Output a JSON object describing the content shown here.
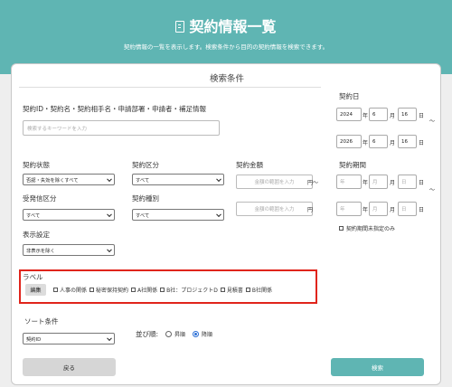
{
  "header": {
    "title": "契約情報一覧",
    "subtitle": "契約情報の一覧を表示します。検索条件から目的の契約情報を検索できます。"
  },
  "panel": {
    "title": "検索条件",
    "keyword": {
      "label": "契約ID・契約名・契約相手名・申請部署・申請者・補足情報",
      "placeholder": "検索するキーワードを入力"
    },
    "contract_date": {
      "label": "契約日",
      "from": {
        "year": "2024",
        "month": "6",
        "day": "16"
      },
      "to": {
        "year": "2026",
        "month": "6",
        "day": "16"
      },
      "year_unit": "年",
      "month_unit": "月",
      "day_unit": "日",
      "range_sep": "〜"
    },
    "status": {
      "label": "契約状態",
      "value": "否認・失効を除くすべて"
    },
    "category": {
      "label": "契約区分",
      "value": "すべて"
    },
    "amount": {
      "label": "契約金額",
      "min_placeholder": "金額の範囲を入力",
      "max_placeholder": "金額の範囲を入力",
      "unit": "円",
      "range_sep": "〜"
    },
    "period": {
      "label": "契約期間",
      "year_ph": "年",
      "month_ph": "月",
      "day_ph": "日",
      "unspecified_label": "契約期間未指定のみ"
    },
    "send_receive": {
      "label": "受発信区分",
      "value": "すべて"
    },
    "type": {
      "label": "契約種別",
      "value": "すべて"
    },
    "display": {
      "label": "表示設定",
      "value": "非表示を除く"
    },
    "labels": {
      "label": "ラベル",
      "edit_button": "編集",
      "items": [
        "人事の関係",
        "秘密保持契約",
        "A社関係",
        "B社：プロジェクトD",
        "見積書",
        "B社関係"
      ]
    },
    "sort": {
      "label": "ソート条件",
      "value": "契約ID",
      "order_label": "並び順:",
      "asc": "昇順",
      "desc": "降順",
      "selected": "desc"
    },
    "back_button": "戻る",
    "search_button": "検索"
  }
}
